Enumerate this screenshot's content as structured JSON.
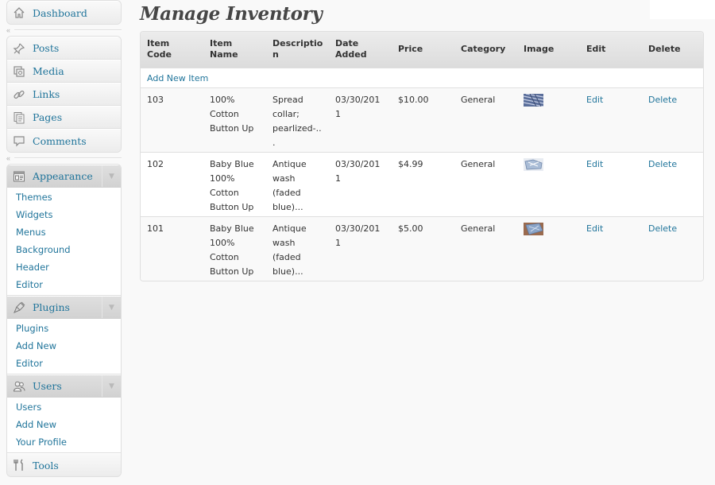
{
  "sidebar": {
    "dashboard": {
      "label": "Dashboard",
      "icon": "home-icon"
    },
    "group2": [
      {
        "label": "Posts",
        "icon": "pin-icon"
      },
      {
        "label": "Media",
        "icon": "media-icon"
      },
      {
        "label": "Links",
        "icon": "link-icon"
      },
      {
        "label": "Pages",
        "icon": "pages-icon"
      },
      {
        "label": "Comments",
        "icon": "comment-icon"
      }
    ],
    "appearance": {
      "label": "Appearance",
      "icon": "appearance-icon",
      "items": [
        "Themes",
        "Widgets",
        "Menus",
        "Background",
        "Header",
        "Editor"
      ]
    },
    "plugins": {
      "label": "Plugins",
      "icon": "plugin-icon",
      "items": [
        "Plugins",
        "Add New",
        "Editor"
      ]
    },
    "users": {
      "label": "Users",
      "icon": "users-icon",
      "items": [
        "Users",
        "Add New",
        "Your Profile"
      ]
    },
    "tools": {
      "label": "Tools",
      "icon": "tools-icon"
    }
  },
  "page": {
    "title": "Manage Inventory"
  },
  "table": {
    "headers": [
      "Item Code",
      "Item Name",
      "Descriptio\nn",
      "Date\nAdded",
      "Price",
      "Category",
      "Image",
      "Edit",
      "Delete"
    ],
    "add_link": "Add New Item",
    "rows": [
      {
        "code": "103",
        "name": "100%\nCotton\nButton Up",
        "description": "Spread\ncollar;\npearlized-..\n.",
        "date": "03/30/201\n1",
        "price": "$10.00",
        "category": "General",
        "image": "shirt-thumbnail",
        "edit": "Edit",
        "delete": "Delete"
      },
      {
        "code": "102",
        "name": "Baby Blue\n100%\nCotton\nButton Up",
        "description": "Antique\nwash (faded\nblue)...",
        "date": "03/30/201\n1",
        "price": "$4.99",
        "category": "General",
        "image": "shirt-thumbnail",
        "edit": "Edit",
        "delete": "Delete"
      },
      {
        "code": "101",
        "name": "Baby Blue\n100%\nCotton\nButton Up",
        "description": "Antique\nwash (faded\nblue)...",
        "date": "03/30/201\n1",
        "price": "$5.00",
        "category": "General",
        "image": "shirt-thumbnail",
        "edit": "Edit",
        "delete": "Delete"
      }
    ]
  },
  "colors": {
    "link": "#21759b",
    "header_bg": "#dfdfdf",
    "title": "#464646"
  }
}
